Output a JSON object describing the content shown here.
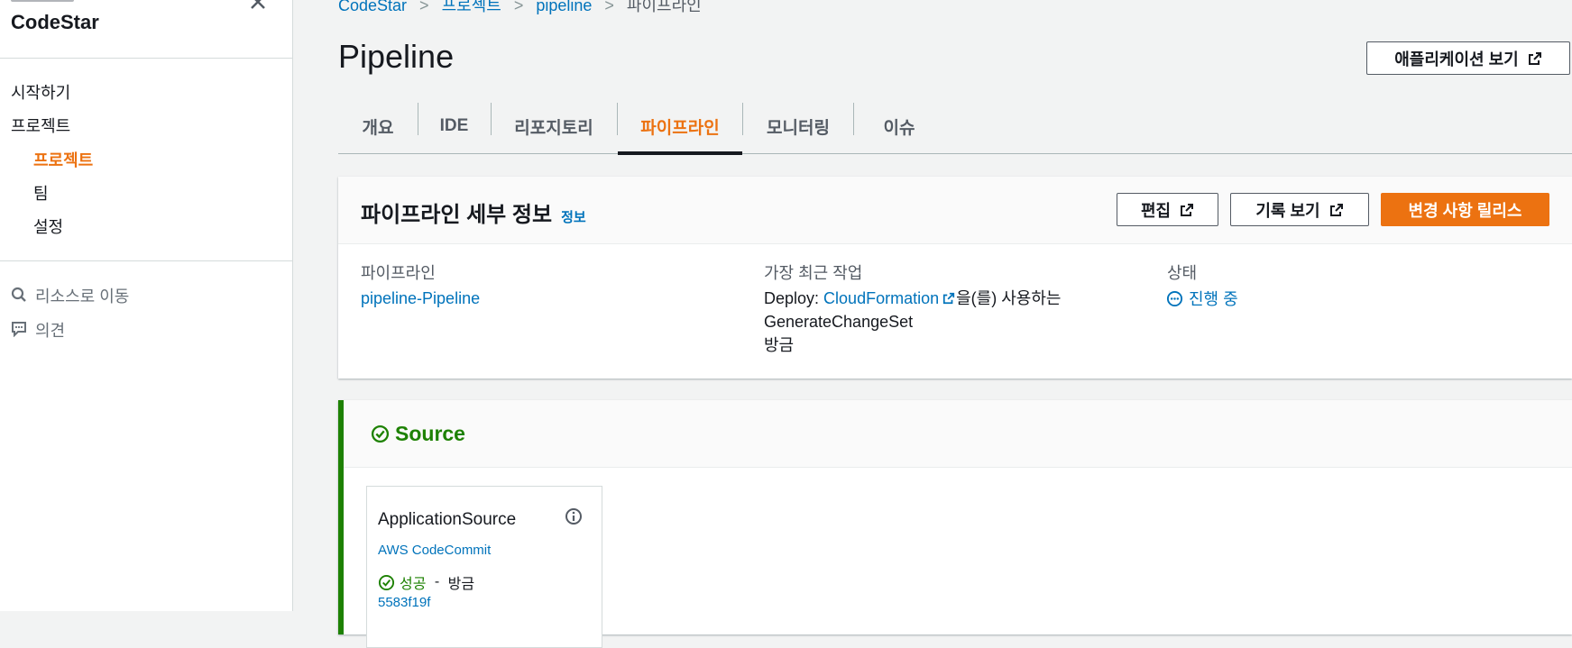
{
  "sidebar": {
    "title": "CodeStar",
    "items": [
      {
        "label": "시작하기"
      },
      {
        "label": "프로젝트"
      },
      {
        "label": "프로젝트"
      },
      {
        "label": "팀"
      },
      {
        "label": "설정"
      }
    ],
    "goto_resource": "리소스로 이동",
    "feedback": "의견"
  },
  "breadcrumb": [
    "CodeStar",
    "프로젝트",
    "pipeline",
    "파이프라인"
  ],
  "header": {
    "title": "Pipeline",
    "view_app_button": "애플리케이션 보기"
  },
  "tabs": [
    "개요",
    "IDE",
    "리포지토리",
    "파이프라인",
    "모니터링",
    "이슈"
  ],
  "active_tab": "파이프라인",
  "details": {
    "title": "파이프라인 세부 정보",
    "info_link": "정보",
    "edit_button": "편집",
    "history_button": "기록 보기",
    "release_button": "변경 사항 릴리스",
    "pipeline_label": "파이프라인",
    "pipeline_value": "pipeline-Pipeline",
    "recent_label": "가장 최근 작업",
    "recent_prefix": "Deploy: ",
    "recent_link": "CloudFormation",
    "recent_suffix": "을(를) 사용하는",
    "recent_line2": "GenerateChangeSet",
    "recent_line3": "방금",
    "status_label": "상태",
    "status_value": "진행 중"
  },
  "stage": {
    "name": "Source",
    "action": {
      "name": "ApplicationSource",
      "provider": "AWS CodeCommit",
      "status": "성공",
      "status_sep": " - ",
      "time": "방금",
      "commit": "5583f19f"
    }
  },
  "colors": {
    "accent": "#ec7211",
    "link": "#0073bb",
    "success": "#1d8102"
  }
}
